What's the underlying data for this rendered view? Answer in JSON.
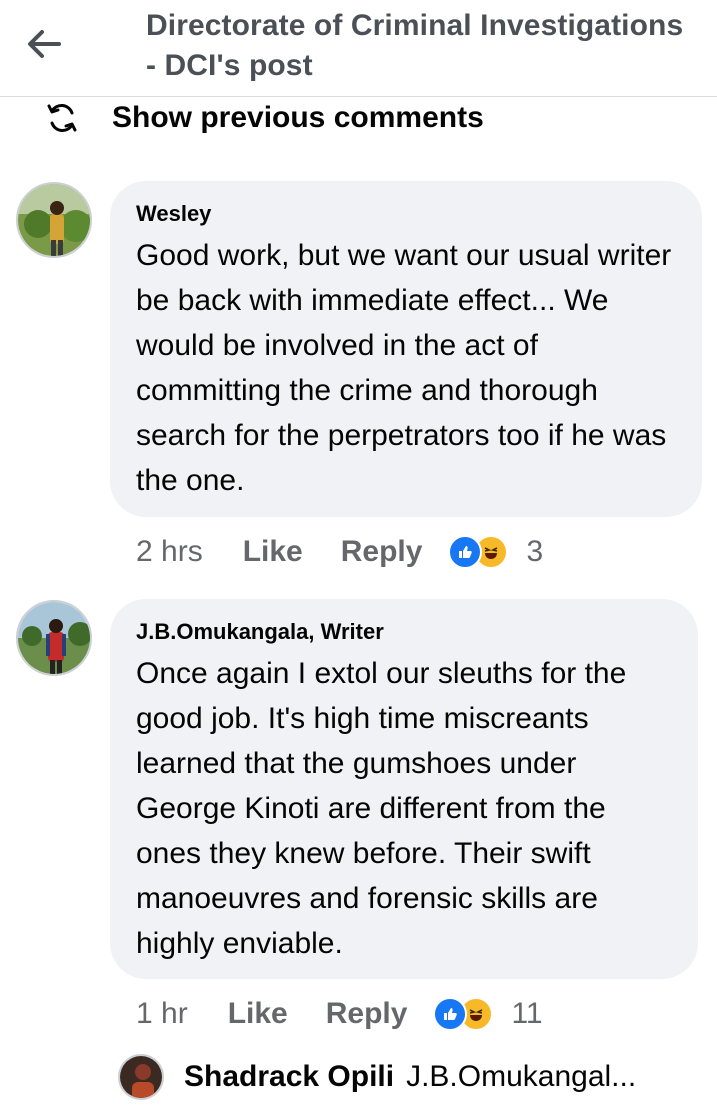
{
  "header": {
    "title": "Directorate of Criminal Investigations - DCI's post",
    "back_icon": "back-arrow-icon"
  },
  "show_previous": {
    "label": "Show previous comments",
    "icon": "refresh-icon"
  },
  "comments": [
    {
      "author": "Wesley",
      "text": "Good work, but we want our usual writer be back with immediate effect... We would be involved in the act of committing the crime and thorough search for the perpetrators too if he was the one.",
      "time": "2 hrs",
      "like_label": "Like",
      "reply_label": "Reply",
      "reaction_count": "3"
    },
    {
      "author": "J.B.Omukangala, Writer",
      "text": "Once again I extol our sleuths for the good job. It's high time miscreants learned that the gumshoes under George Kinoti are different from the ones they knew before. Their swift manoeuvres and forensic skills are highly enviable.",
      "time": "1 hr",
      "like_label": "Like",
      "reply_label": "Reply",
      "reaction_count": "11"
    }
  ],
  "reply_preview": {
    "author": "Shadrack Opili",
    "text": "J.B.Omukangal..."
  },
  "colors": {
    "bubble": "#f0f2f5",
    "like": "#1877f2",
    "haha": "#f7b928",
    "meta_text": "#65676b"
  }
}
